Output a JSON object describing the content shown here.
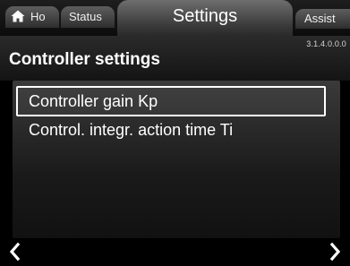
{
  "tabs": {
    "home_label": "Ho",
    "status_label": "Status",
    "settings_label": "Settings",
    "assist_label": "Assist"
  },
  "version": "3.1.4.0.0.0",
  "page_title": "Controller settings",
  "menu_items": [
    {
      "label": "Controller gain Kp",
      "selected": true
    },
    {
      "label": "Control. integr. action time Ti",
      "selected": false
    }
  ],
  "icons": {
    "home": "home-icon",
    "back": "chevron-left-icon",
    "forward": "chevron-right-icon"
  },
  "colors": {
    "background": "#000000",
    "text": "#ffffff",
    "selection_border": "#ffffff"
  }
}
